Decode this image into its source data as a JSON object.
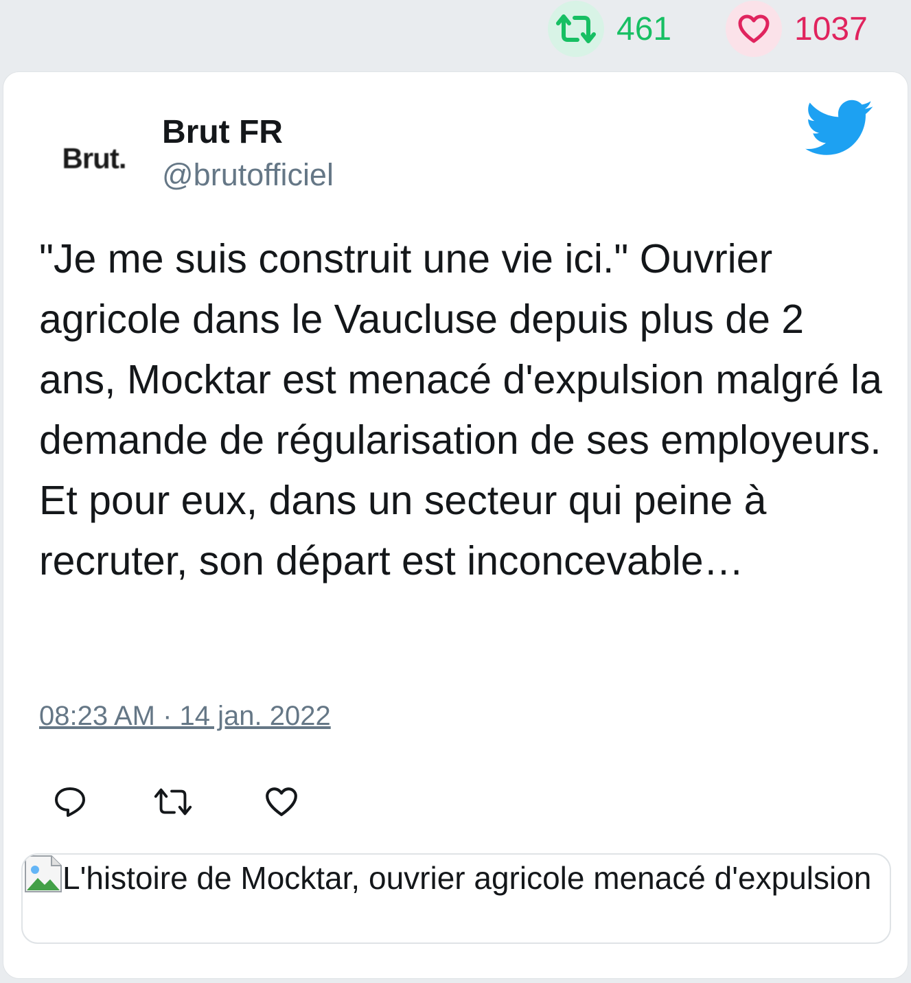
{
  "stats": {
    "retweets": "461",
    "likes": "1037",
    "colors": {
      "retweet": "#17bf63",
      "like": "#e0245e"
    }
  },
  "tweet": {
    "avatar_text": "Brut.",
    "author_name": "Brut FR",
    "author_handle": "@brutofficiel",
    "text": "\"Je me suis construit une vie ici.\" Ouvrier agricole dans le Vaucluse depuis plus de 2 ans, Mocktar est menacé d'expulsion malgré la demande de régularisation de ses employeurs. Et pour eux, dans un secteur qui peine à recruter, son départ est inconcevable…",
    "timestamp": "08:23 AM · 14 jan. 2022",
    "icons": [
      "reply-icon",
      "retweet-icon",
      "like-icon",
      "twitter-bird-icon"
    ],
    "brand_color": "#1da1f2"
  },
  "embed": {
    "alt_text": "L'histoire de Mocktar, ouvrier agricole menacé d'expulsion"
  }
}
